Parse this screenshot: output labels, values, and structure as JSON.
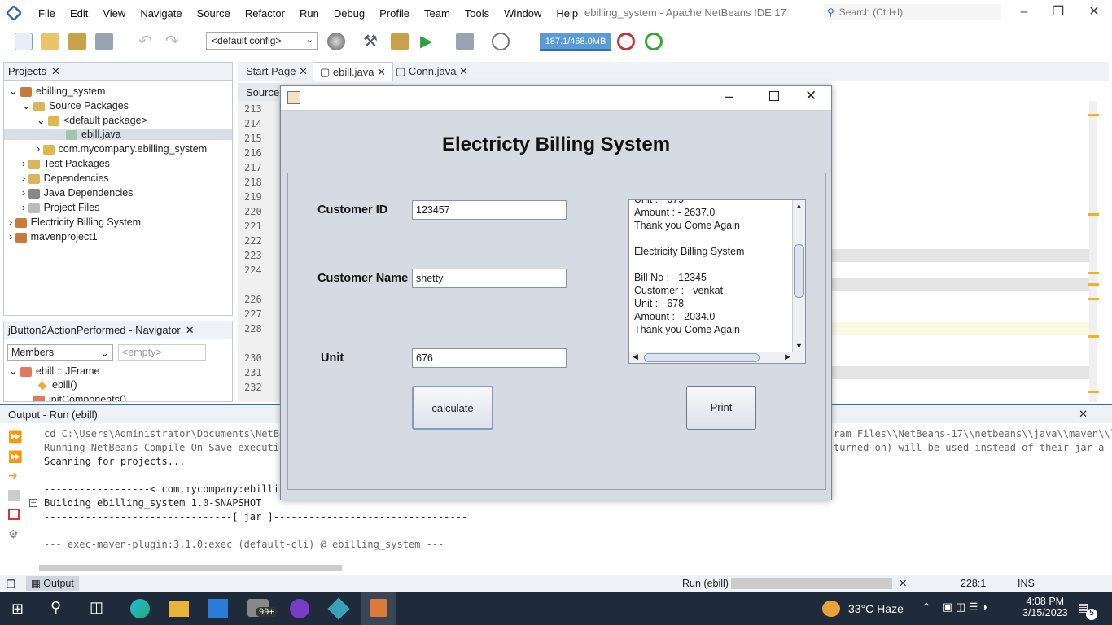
{
  "ide": {
    "title": "ebilling_system - Apache NetBeans IDE 17",
    "search_placeholder": "Search (Ctrl+I)",
    "menu": [
      "File",
      "Edit",
      "View",
      "Navigate",
      "Source",
      "Refactor",
      "Run",
      "Debug",
      "Profile",
      "Team",
      "Tools",
      "Window",
      "Help"
    ],
    "config": "<default config>",
    "memory": "187.1/468.0MB"
  },
  "projects": {
    "title": "Projects",
    "items": [
      "ebilling_system",
      "Source Packages",
      "<default package>",
      "ebill.java",
      "com.mycompany.ebilling_system",
      "Test Packages",
      "Dependencies",
      "Java Dependencies",
      "Project Files",
      "Electricity Billing System",
      "mavenproject1"
    ]
  },
  "navigator": {
    "title": "jButton2ActionPerformed - Navigator",
    "members": "Members",
    "empty": "<empty>",
    "items": [
      "ebill :: JFrame",
      "ebill()",
      "initComponents()"
    ]
  },
  "editor": {
    "tabs": [
      "Start Page",
      "ebill.java",
      "Conn.java"
    ],
    "source_tab": "Source",
    "lines": [
      "213",
      "214",
      "215",
      "216",
      "217",
      "218",
      "219",
      "220",
      "221",
      "222",
      "223",
      "224",
      "",
      "226",
      "227",
      "228",
      "",
      "230",
      "231",
      "232"
    ]
  },
  "output": {
    "title": "Output - Run (ebill)",
    "lines": [
      "cd C:\\Users\\Administrator\\Documents\\NetBea",
      "Running NetBeans Compile On Save executio",
      "Scanning for projects...",
      "",
      "------------------< com.mycompany:ebillir",
      "Building ebilling_system 1.0-SNAPSHOT",
      "--------------------------------[ jar ]---------------------------------",
      "",
      "--- exec-maven-plugin:3.1.0:exec (default-cli) @ ebilling_system ---"
    ],
    "right_1": "ram Files\\\\NetBeans-17\\\\netbeans\\\\java\\\\maven\\\\l",
    "right_2": "turned on) will be used instead of their jar a"
  },
  "status": {
    "output_tab": "Output",
    "run": "Run (ebill)",
    "pos": "228:1",
    "mode": "INS"
  },
  "dialog": {
    "heading": "Electricty Billing System",
    "labels": {
      "customer_id": "Customer ID",
      "customer_name": "Customer Name",
      "unit": "Unit"
    },
    "values": {
      "customer_id": "123457",
      "customer_name": "shetty",
      "unit": "676"
    },
    "buttons": {
      "calculate": "calculate",
      "print": "Print"
    },
    "receipt": [
      "Unit  : - 679",
      "Amount  : - 2637.0",
      "Thank you Come Again",
      "",
      "Electricity Billing System",
      "",
      "Bill No : - 12345",
      "Customer : - venkat",
      "Unit  : - 678",
      "Amount  : - 2034.0",
      "Thank you Come Again"
    ]
  },
  "taskbar": {
    "weather": "33°C  Haze",
    "time": "4:08 PM",
    "date": "3/15/2023",
    "badge": "99+",
    "notif": "5"
  }
}
